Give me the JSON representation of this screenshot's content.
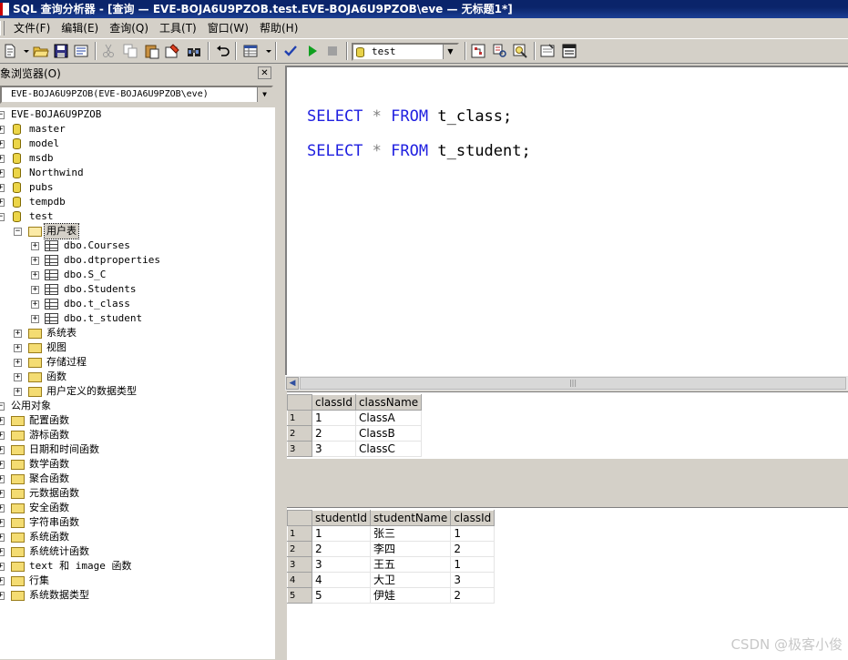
{
  "window": {
    "title": "SQL 查询分析器 - [查询 — EVE-BOJA6U9PZOB.test.EVE-BOJA6U9PZOB\\eve — 无标题1*]"
  },
  "menu": [
    "文件(F)",
    "编辑(E)",
    "查询(Q)",
    "工具(T)",
    "窗口(W)",
    "帮助(H)"
  ],
  "toolbar": {
    "icons": [
      "new-query-icon",
      "open-icon",
      "save-icon",
      "load-sql-icon",
      "cut-icon",
      "copy-icon",
      "paste-icon",
      "clear-icon",
      "find-icon",
      "undo-icon",
      "results-mode-icon",
      "parse-icon",
      "execute-icon",
      "cancel-icon",
      "object-browser-icon",
      "object-search-icon",
      "estimated-plan-icon",
      "show-results-icon",
      "options-icon",
      "results-pane-icon"
    ],
    "database": "test"
  },
  "object_browser": {
    "title": "象浏览器(O)",
    "server": "EVE-BOJA6U9PZOB(EVE-BOJA6U9PZOB\\eve)",
    "root": "EVE-BOJA6U9PZOB",
    "databases": [
      "master",
      "model",
      "msdb",
      "Northwind",
      "pubs",
      "tempdb",
      "test"
    ],
    "test_folder": "用户表",
    "tables": [
      "dbo.Courses",
      "dbo.dtproperties",
      "dbo.S_C",
      "dbo.Students",
      "dbo.t_class",
      "dbo.t_student"
    ],
    "test_subfolders": [
      "系统表",
      "视图",
      "存储过程",
      "函数",
      "用户定义的数据类型"
    ],
    "common_objects": "公用对象",
    "common_folders": [
      "配置函数",
      "游标函数",
      "日期和时间函数",
      "数学函数",
      "聚合函数",
      "元数据函数",
      "安全函数",
      "字符串函数",
      "系统函数",
      "系统统计函数",
      "text 和 image 函数",
      "行集",
      "系统数据类型"
    ]
  },
  "editor": {
    "lines": [
      {
        "kw1": "SELECT",
        "op": "*",
        "kw2": "FROM",
        "table": "t_class;"
      },
      {
        "kw1": "SELECT",
        "op": "*",
        "kw2": "FROM",
        "table": "t_student;"
      }
    ]
  },
  "results": [
    {
      "columns": [
        "classId",
        "className"
      ],
      "rows": [
        [
          "1",
          "1",
          "ClassA"
        ],
        [
          "2",
          "2",
          "ClassB"
        ],
        [
          "3",
          "3",
          "ClassC"
        ]
      ]
    },
    {
      "columns": [
        "studentId",
        "studentName",
        "classId"
      ],
      "rows": [
        [
          "1",
          "1",
          "张三",
          "1"
        ],
        [
          "2",
          "2",
          "李四",
          "2"
        ],
        [
          "3",
          "3",
          "王五",
          "1"
        ],
        [
          "4",
          "4",
          "大卫",
          "3"
        ],
        [
          "5",
          "5",
          "伊娃",
          "2"
        ]
      ]
    }
  ],
  "watermark": "CSDN @极客小俊",
  "colors": {
    "keyword": "#2020e0",
    "titlebar": "#0a246a",
    "chrome": "#d4d0c8"
  }
}
